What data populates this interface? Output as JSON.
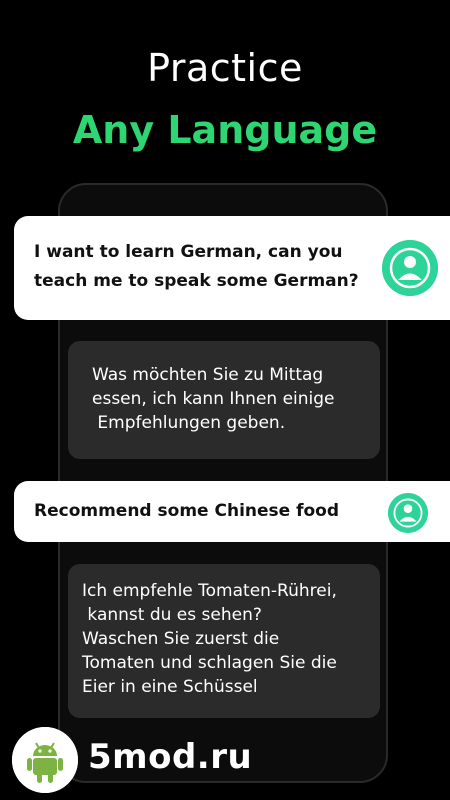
{
  "header": {
    "line1": "Practice",
    "line2": "Any Language",
    "accent_color": "#2ed573"
  },
  "conversation": {
    "user_message_1": {
      "lines": [
        "I want to learn German, can you",
        "teach me to speak some German?"
      ]
    },
    "reply_1": {
      "lines": [
        "Was möchten Sie zu Mittag",
        "essen, ich kann Ihnen einige",
        " Empfehlungen geben."
      ]
    },
    "user_message_2": {
      "text": "Recommend some Chinese food"
    },
    "reply_2": {
      "lines": [
        "Ich empfehle Tomaten-Rührei,",
        " kannst du es sehen?",
        "Waschen Sie zuerst die",
        "Tomaten und schlagen Sie die",
        "Eier in eine Schüssel"
      ]
    }
  },
  "icons": {
    "user_avatar": "user-avatar-icon",
    "watermark_logo": "android-icon"
  },
  "watermark": {
    "text": "5mod.ru",
    "logo_color": "#7cb342"
  }
}
